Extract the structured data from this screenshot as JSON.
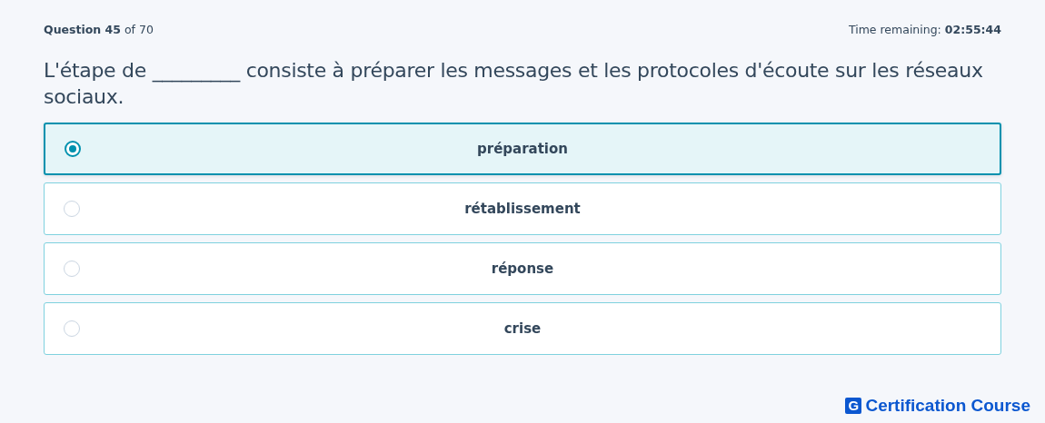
{
  "header": {
    "progress": "**Question 45** of 70",
    "timer": "Time remaining: **02:55:44**"
  },
  "question": "L'étape de _________ consiste à préparer les messages et les protocoles d'écoute sur les réseaux sociaux.",
  "options": [
    {
      "label": "préparation",
      "selected": true
    },
    {
      "label": "rétablissement",
      "selected": false
    },
    {
      "label": "réponse",
      "selected": false
    },
    {
      "label": "crise",
      "selected": false
    }
  ],
  "logo": {
    "mark": "G",
    "name": "Certification Course"
  }
}
